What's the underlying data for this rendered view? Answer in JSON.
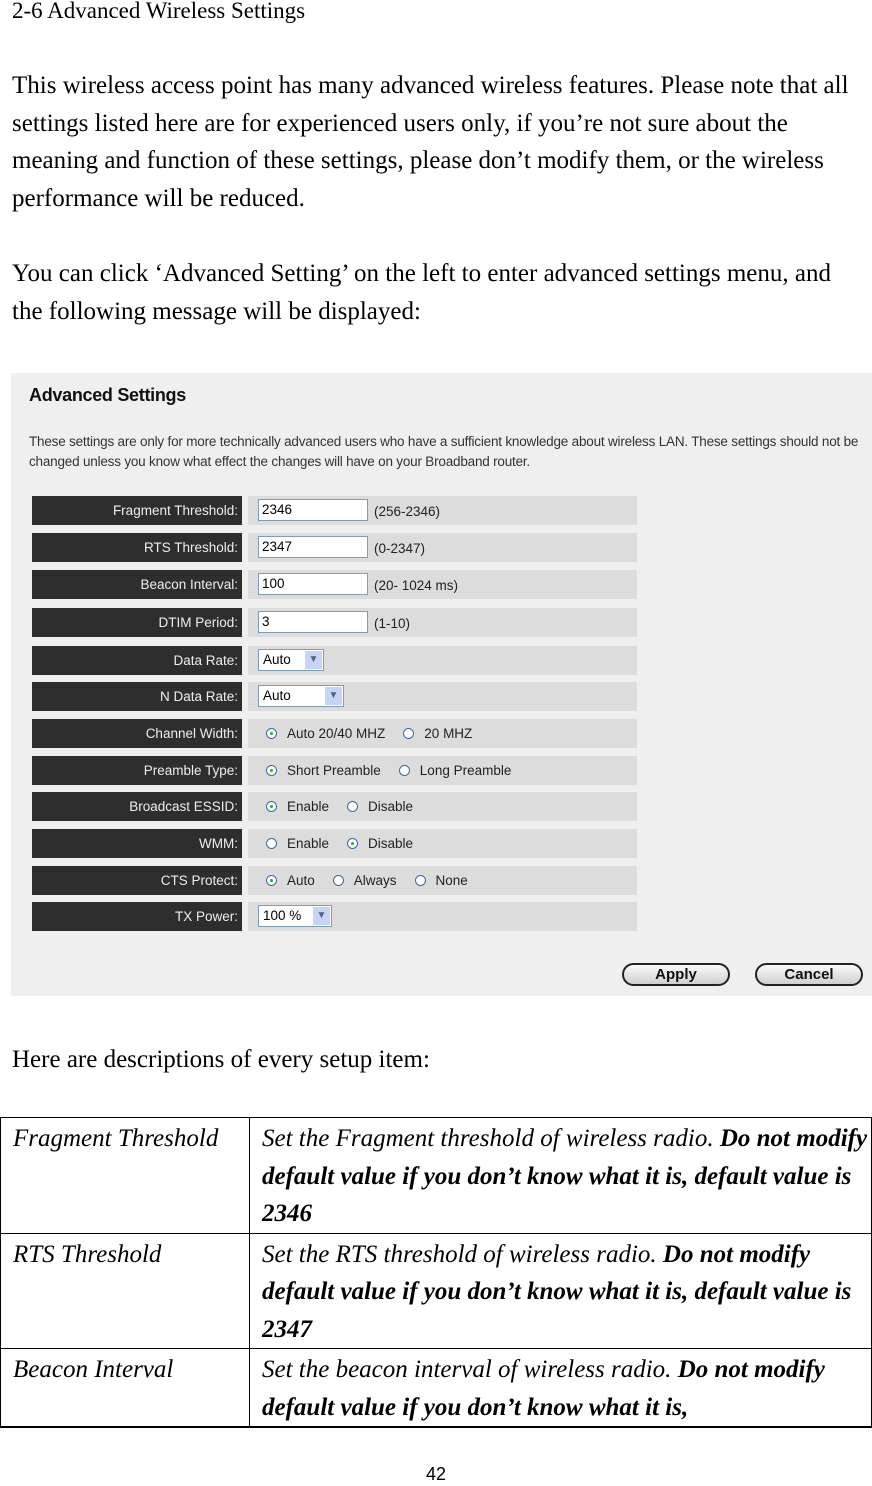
{
  "heading": "2-6 Advanced Wireless Settings",
  "paragraph1": "This wireless access point has many advanced wireless features. Please note that all settings listed here are for experienced users only, if you’re not sure about the meaning and function of these settings, please don’t modify them, or the wireless performance will be reduced.",
  "paragraph2": "You can click ‘Advanced Setting’ on the left to enter advanced settings menu, and the following message will be displayed:",
  "panel": {
    "title": "Advanced Settings",
    "description": "These settings are only for more technically advanced users who have a sufficient knowledge about wireless LAN. These settings should not be changed unless you know what effect the changes will have on your Broadband router.",
    "fields": {
      "fragment_threshold": {
        "label": "Fragment Threshold:",
        "value": "2346",
        "hint": "(256-2346)"
      },
      "rts_threshold": {
        "label": "RTS Threshold:",
        "value": "2347",
        "hint": "(0-2347)"
      },
      "beacon_interval": {
        "label": "Beacon Interval:",
        "value": "100",
        "hint": "(20- 1024 ms)"
      },
      "dtim_period": {
        "label": "DTIM Period:",
        "value": "3",
        "hint": "(1-10)"
      },
      "data_rate": {
        "label": "Data Rate:",
        "selected": "Auto"
      },
      "n_data_rate": {
        "label": "N Data Rate:",
        "selected": "Auto"
      },
      "channel_width": {
        "label": "Channel Width:",
        "options": [
          "Auto 20/40 MHZ",
          "20 MHZ"
        ],
        "selected": "Auto 20/40 MHZ"
      },
      "preamble_type": {
        "label": "Preamble Type:",
        "options": [
          "Short Preamble",
          "Long Preamble"
        ],
        "selected": "Short Preamble"
      },
      "broadcast_essid": {
        "label": "Broadcast ESSID:",
        "options": [
          "Enable",
          "Disable"
        ],
        "selected": "Enable"
      },
      "wmm": {
        "label": "WMM:",
        "options": [
          "Enable",
          "Disable"
        ],
        "selected": "Disable"
      },
      "cts_protect": {
        "label": "CTS Protect:",
        "options": [
          "Auto",
          "Always",
          "None"
        ],
        "selected": "Auto"
      },
      "tx_power": {
        "label": "TX Power:",
        "selected": "100 %"
      }
    },
    "apply_label": "Apply",
    "cancel_label": "Cancel",
    "dropdown_icon": "chevron-down-icon"
  },
  "desc_intro": "Here are descriptions of every setup item:",
  "descriptions": [
    {
      "item": "Fragment Threshold",
      "text": "Set the Fragment threshold of wireless radio. ",
      "bold": "Do not modify default value if you don’t know what it is, default value is 2346"
    },
    {
      "item": "RTS Threshold",
      "text": "Set the RTS threshold of wireless radio. ",
      "bold": "Do not modify default value if you don’t know what it is, default value is 2347"
    },
    {
      "item": "Beacon Interval",
      "text": "Set the beacon interval of wireless radio. ",
      "bold": "Do not modify default value if you don’t know what it is,"
    }
  ],
  "page_number": "42"
}
